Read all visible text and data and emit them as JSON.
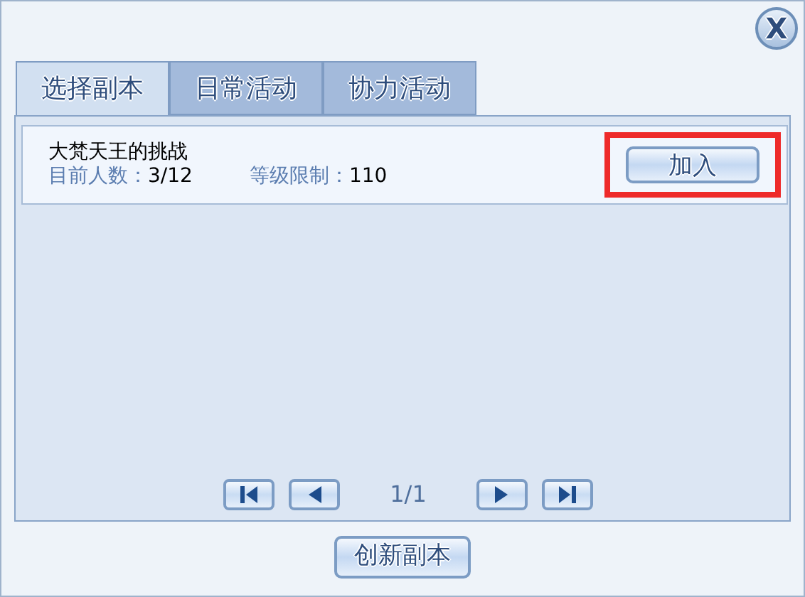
{
  "close_button": {
    "label": "X"
  },
  "tabs": [
    {
      "label": "选择副本",
      "selected": true
    },
    {
      "label": "日常活动",
      "selected": false
    },
    {
      "label": "协力活动",
      "selected": false
    }
  ],
  "dungeons": [
    {
      "name": "大梵天王的挑战",
      "players_label": "目前人数：",
      "players": "3/12",
      "level_label": "等级限制：",
      "level": "110",
      "action": "加入",
      "highlighted": true
    }
  ],
  "pager": {
    "page": "1/1"
  },
  "create_button": {
    "label": "创新副本"
  }
}
